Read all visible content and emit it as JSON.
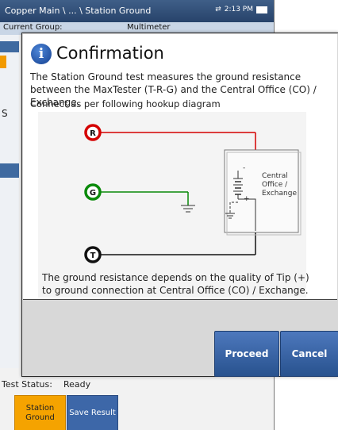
{
  "statusbar": {
    "breadcrumb": "Copper Main \\ ... \\ Station Ground",
    "time": "2:13 PM"
  },
  "background": {
    "current_group_label": "Current Group:",
    "current_group_value": "Multimeter",
    "side_label": "S",
    "test_status_label": "Test Status:",
    "test_status_value": "Ready",
    "tabs": [
      {
        "label": "Station Ground"
      },
      {
        "label": "Save Result"
      }
    ]
  },
  "dialog": {
    "title": "Confirmation",
    "description": "The Station Ground test measures the ground resistance between the MaxTester (T-R-G) and the Central Office (CO) / Exchange.",
    "instruction": "Connect as per following hookup diagram",
    "note": "The ground resistance depends on the quality of Tip (+) to ground connection at Central Office (CO) / Exchange.",
    "buttons": {
      "proceed": "Proceed",
      "cancel": "Cancel"
    }
  },
  "diagram": {
    "terminals": [
      {
        "letter": "R",
        "color": "#d40000"
      },
      {
        "letter": "G",
        "color": "#0a8a0a"
      },
      {
        "letter": "T",
        "color": "#111111"
      }
    ],
    "box_label_lines": [
      "Central",
      "Office /",
      "Exchange"
    ],
    "plus_sign": "+",
    "minus_sign": "-"
  }
}
